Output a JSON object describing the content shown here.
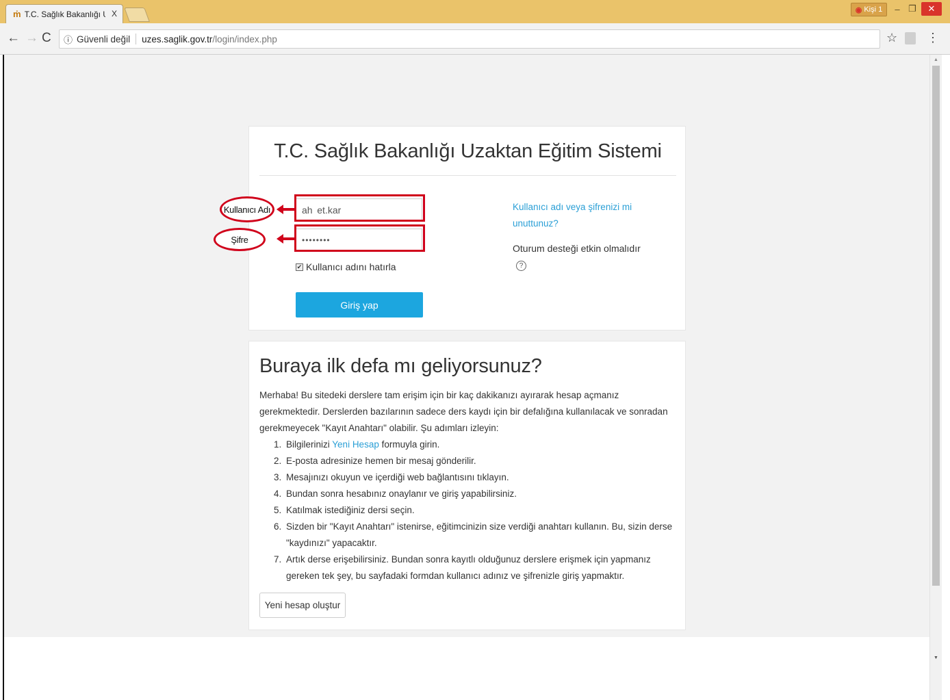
{
  "browser": {
    "tab_title": "T.C. Sağlık Bakanlığı Uza",
    "tab_close": "X",
    "profile_label": "Kişi 1",
    "security_label": "Güvenli değil",
    "url_host": "uzes.saglik.gov.tr",
    "url_path": "/login/index.php"
  },
  "login": {
    "title": "T.C. Sağlık Bakanlığı Uzaktan Eğitim Sistemi",
    "username_value": "ah  et.kar",
    "password_value": "••••••••",
    "remember_label": "Kullanıcı adını hatırla",
    "submit_label": "Giriş yap",
    "forgot_link": "Kullanıcı adı veya şifrenizi mi unuttunuz?",
    "session_note": "Oturum desteği etkin olmalıdır"
  },
  "annotations": {
    "username_label": "Kullanıcı Adı",
    "password_label": "Şifre",
    "color": "#d0021b"
  },
  "info": {
    "title": "Buraya ilk defa mı geliyorsunuz?",
    "intro": "Merhaba! Bu sitedeki derslere tam erişim için bir kaç dakikanızı ayırarak hesap açmanız gerekmektedir. Derslerden bazılarının sadece ders kaydı için bir defalığına kullanılacak ve sonradan gerekmeyecek \"Kayıt Anahtarı\" olabilir. Şu adımları izleyin:",
    "step1_pre": "Bilgilerinizi ",
    "step1_link": "Yeni Hesap",
    "step1_post": " formuyla girin.",
    "steps": [
      "E-posta adresinize hemen bir mesaj gönderilir.",
      "Mesajınızı okuyun ve içerdiği web bağlantısını tıklayın.",
      "Bundan sonra hesabınız onaylanır ve giriş yapabilirsiniz.",
      "Katılmak istediğiniz dersi seçin.",
      "Sizden bir \"Kayıt Anahtarı\" istenirse, eğitimcinizin size verdiği anahtarı kullanın. Bu, sizin derse \"kaydınızı\" yapacaktır.",
      "Artık derse erişebilirsiniz. Bundan sonra kayıtlı olduğunuz derslere erişmek için yapmanız gereken tek şey, bu sayfadaki formdan kullanıcı adınız ve şifrenizle giriş yapmaktır."
    ],
    "numbers": [
      "1.",
      "2.",
      "3.",
      "4.",
      "5.",
      "6.",
      "7."
    ],
    "create_button": "Yeni hesap oluştur"
  },
  "colors": {
    "accent": "#1ca6df",
    "link": "#2a9fd6",
    "titlebar": "#eac36a"
  }
}
